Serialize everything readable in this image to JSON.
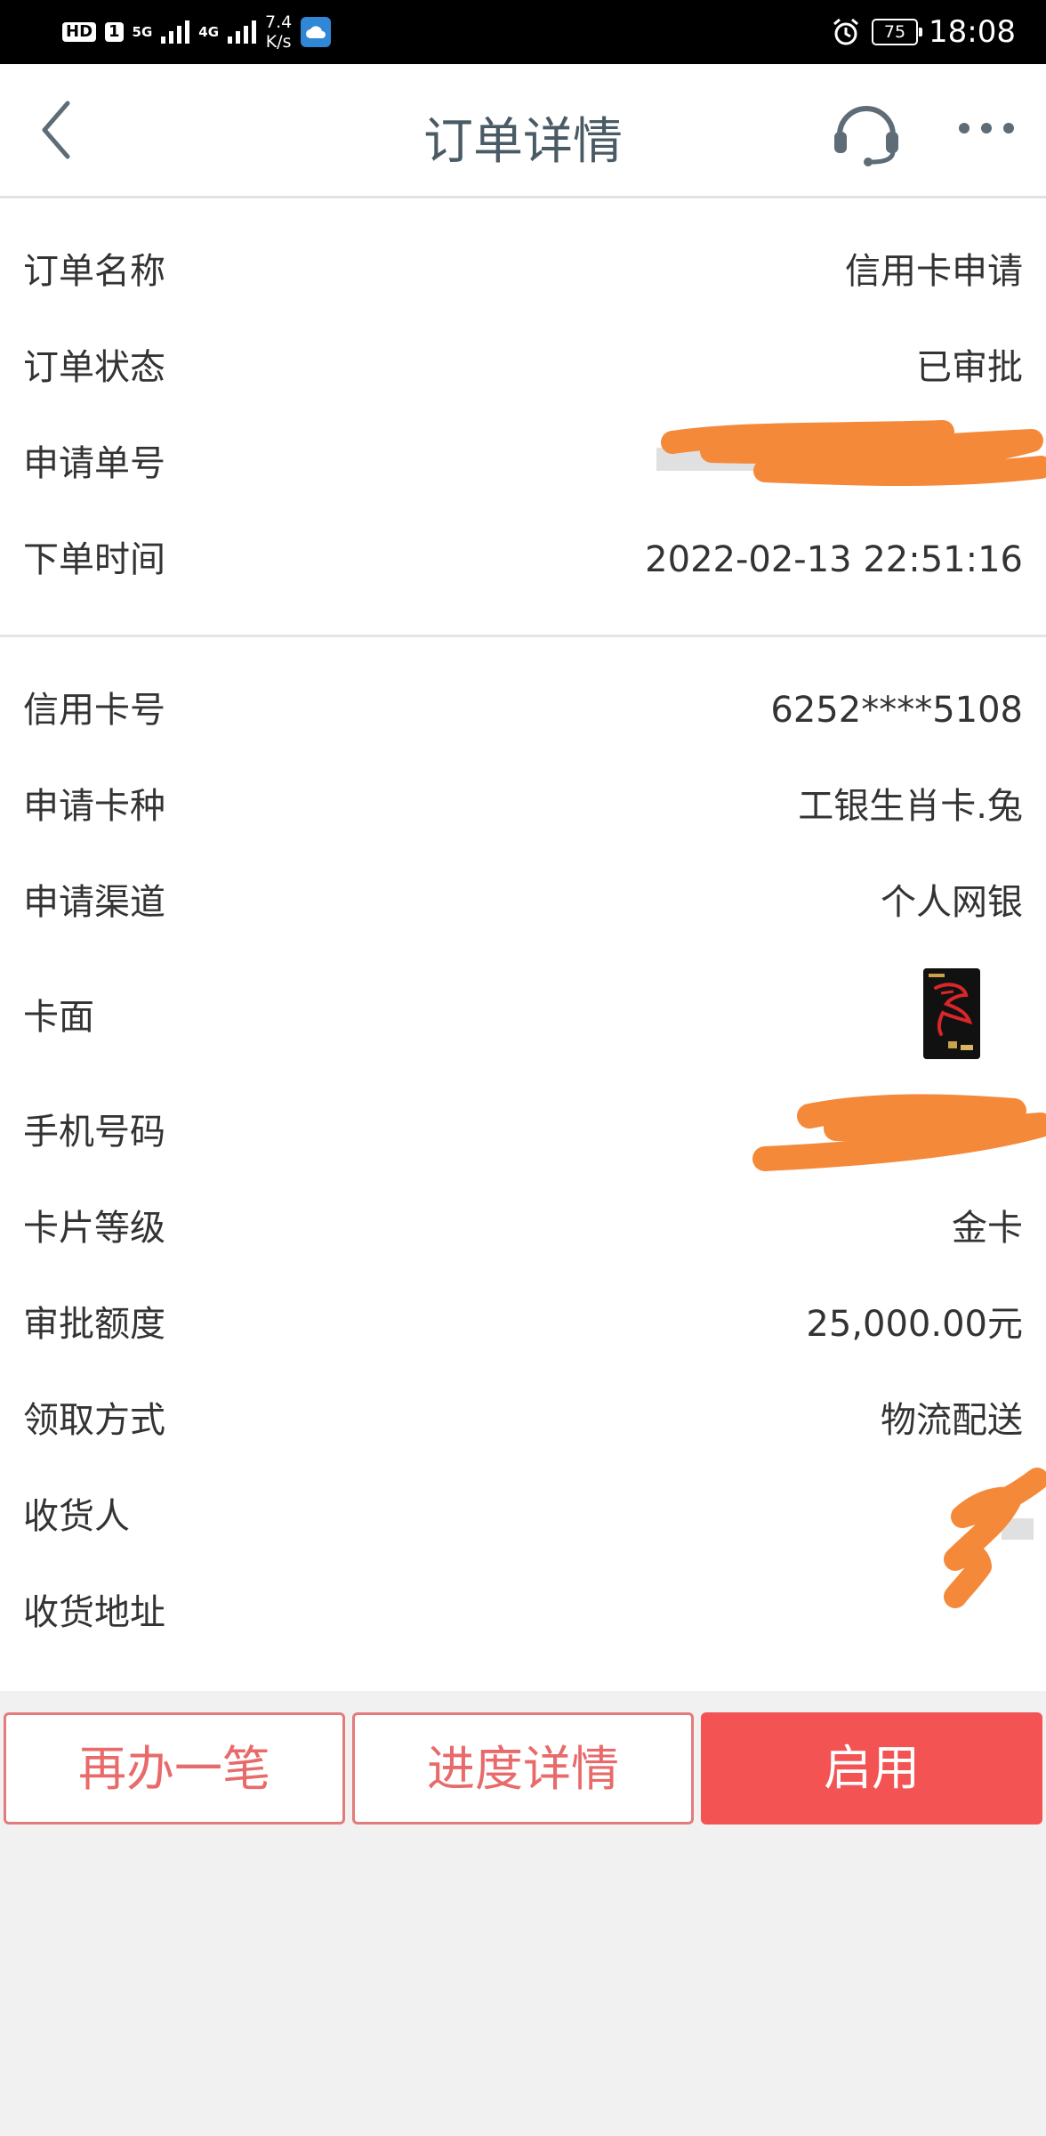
{
  "status_bar": {
    "hd_label": "HD",
    "sim_label": "1",
    "net1": "5G",
    "net2": "4G",
    "speed_value": "7.4",
    "speed_unit": "K/s",
    "battery": "75",
    "time": "18:08"
  },
  "header": {
    "title": "订单详情",
    "icons": {
      "back": "chevron-left",
      "support": "headset",
      "more": "ellipsis"
    }
  },
  "order": {
    "name_label": "订单名称",
    "name_value": "信用卡申请",
    "status_label": "订单状态",
    "status_value": "已审批",
    "number_label": "申请单号",
    "time_label": "下单时间",
    "time_value": "2022-02-13 22:51:16"
  },
  "card": {
    "number_label": "信用卡号",
    "number_value": "6252****5108",
    "type_label": "申请卡种",
    "type_value": "工银生肖卡.兔",
    "channel_label": "申请渠道",
    "channel_value": "个人网银",
    "face_label": "卡面",
    "phone_label": "手机号码",
    "level_label": "卡片等级",
    "level_value": "金卡",
    "limit_label": "审批额度",
    "limit_value": "25,000.00元",
    "pickup_label": "领取方式",
    "pickup_value": "物流配送",
    "recipient_label": "收货人",
    "address_label": "收货地址"
  },
  "actions": {
    "again_label": "再办一笔",
    "progress_label": "进度详情",
    "activate_label": "启用"
  },
  "colors": {
    "accent": "#f35353",
    "outline": "#e47b7b",
    "title": "#4a5b66",
    "redaction": "#f5893a"
  }
}
